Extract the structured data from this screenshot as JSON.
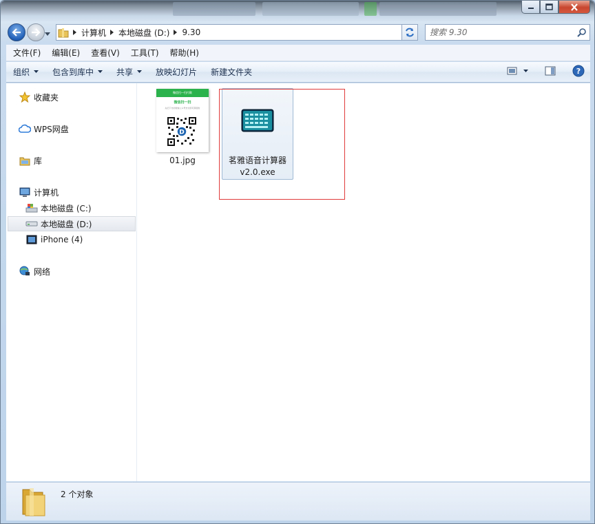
{
  "window": {
    "search_placeholder": "搜索 9.30"
  },
  "breadcrumb": [
    "计算机",
    "本地磁盘 (D:)",
    "9.30"
  ],
  "menubar": [
    "文件(F)",
    "编辑(E)",
    "查看(V)",
    "工具(T)",
    "帮助(H)"
  ],
  "toolbar": {
    "organize": "组织",
    "include_in_library": "包含到库中",
    "share": "共享",
    "slideshow": "放映幻灯片",
    "new_folder": "新建文件夹"
  },
  "nav": {
    "favorites": "收藏夹",
    "wps": "WPS网盘",
    "libraries": "库",
    "computer": "计算机",
    "drive_c": "本地磁盘 (C:)",
    "drive_d": "本地磁盘 (D:)",
    "iphone": "iPhone (4)",
    "network": "网络"
  },
  "files": [
    {
      "name": "01.jpg",
      "type": "image",
      "thumb_header": "微信扫一扫付款",
      "thumb_title": "微信扫一扫",
      "thumb_caption": "先扫下方的微信公众号支付即可算服务"
    },
    {
      "name_line1": "茗雅语音计算器",
      "name_line2": "v2.0.exe",
      "type": "exe"
    }
  ],
  "status": {
    "count_text": "2 个对象"
  },
  "colors": {
    "accent": "#1f5fb8",
    "selection_border": "#9fb8d4",
    "annotation_red": "#e03a3a",
    "wechat_green": "#2bb24c"
  }
}
